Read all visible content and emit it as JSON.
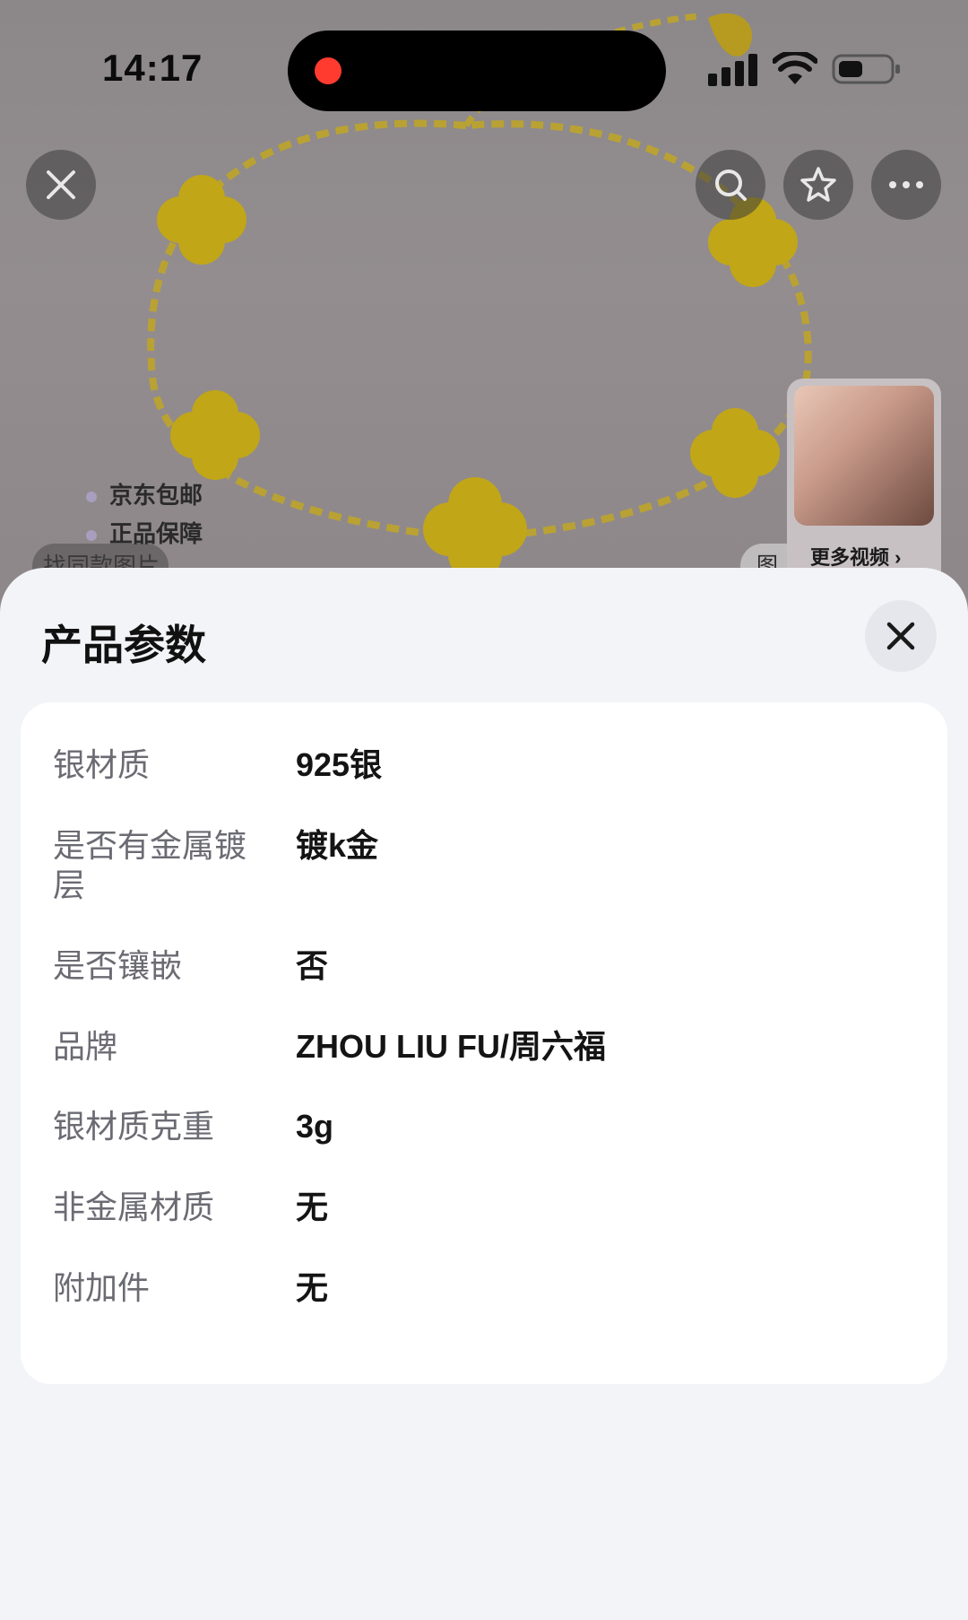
{
  "status_bar": {
    "time": "14:17"
  },
  "background": {
    "promos": [
      "京东包邮",
      "正品保障"
    ],
    "partial_labels": [
      "找同款图片",
      "图"
    ],
    "video_card": {
      "label": "更多视频 ›"
    }
  },
  "sheet": {
    "title": "产品参数",
    "params": [
      {
        "label": "银材质",
        "value": "925银"
      },
      {
        "label": "是否有金属镀层",
        "value": "镀k金"
      },
      {
        "label": "是否镶嵌",
        "value": "否"
      },
      {
        "label": "品牌",
        "value": "ZHOU LIU FU/周六福"
      },
      {
        "label": "银材质克重",
        "value": "3g"
      },
      {
        "label": "非金属材质",
        "value": "无"
      },
      {
        "label": "附加件",
        "value": "无"
      }
    ]
  },
  "icons": {
    "close_top": "close-icon",
    "search": "search-icon",
    "favorite": "star-icon",
    "more": "more-icon",
    "sheet_close": "close-icon"
  }
}
